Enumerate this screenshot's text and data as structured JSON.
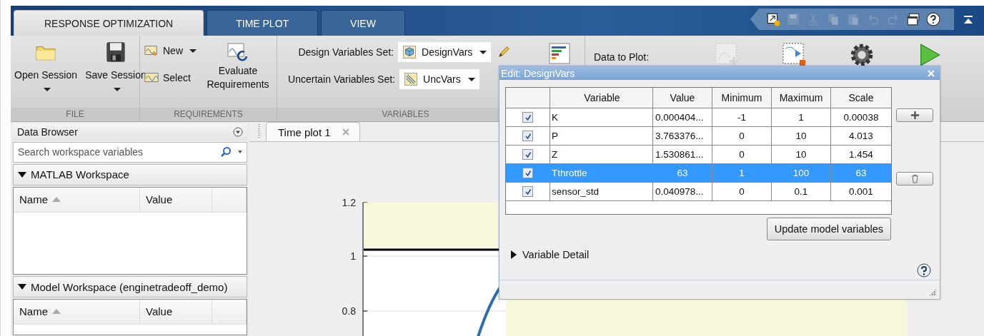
{
  "tabs": [
    {
      "label": "RESPONSE OPTIMIZATION",
      "selected": true
    },
    {
      "label": "TIME PLOT",
      "selected": false
    },
    {
      "label": "VIEW",
      "selected": false
    }
  ],
  "file_section": {
    "title": "FILE",
    "open": "Open Session",
    "save": "Save Session"
  },
  "requirements_section": {
    "title": "REQUIREMENTS",
    "new": "New",
    "select": "Select",
    "evaluate": "Evaluate Requirements"
  },
  "variables_section": {
    "title": "VARIABLES",
    "design_label": "Design Variables Set:",
    "design_value": "DesignVars",
    "uncertain_label": "Uncertain Variables Set:",
    "uncertain_value": "UncVars"
  },
  "data_to_plot_label": "Data to Plot:",
  "data_browser": {
    "title": "Data Browser",
    "placeholder": "Search workspace variables",
    "sections": [
      {
        "title": "MATLAB Workspace",
        "expanded": true,
        "columns": [
          "Name",
          "Value"
        ]
      },
      {
        "title": "Model Workspace (enginetradeoff_demo)",
        "expanded": true,
        "columns": [
          "Name",
          "Value"
        ]
      }
    ]
  },
  "plot_tabs": [
    {
      "label": "Time plot 1",
      "selected": true
    }
  ],
  "plot": {
    "y_tick_labels": [
      "1.2",
      "1",
      "0.8"
    ]
  },
  "dialog": {
    "title": "Edit: DesignVars",
    "columns": [
      "Variable",
      "Value",
      "Minimum",
      "Maximum",
      "Scale"
    ],
    "rows": [
      {
        "checked": true,
        "selected": false,
        "cells": [
          "K",
          "0.000404...",
          "-1",
          "1",
          "0.00038"
        ]
      },
      {
        "checked": true,
        "selected": false,
        "cells": [
          "P",
          "3.763376...",
          "0",
          "10",
          "4.013"
        ]
      },
      {
        "checked": true,
        "selected": false,
        "cells": [
          "Z",
          "1.530861...",
          "0",
          "10",
          "1.454"
        ]
      },
      {
        "checked": true,
        "selected": true,
        "cells": [
          "Tthrottle",
          "63",
          "1",
          "100",
          "63"
        ]
      },
      {
        "checked": true,
        "selected": false,
        "cells": [
          "sensor_std",
          "0.040978...",
          "0",
          "0.1",
          "0.001"
        ]
      }
    ],
    "update_button": "Update model variables",
    "detail": {
      "label": "Variable Detail",
      "expanded": false
    }
  }
}
